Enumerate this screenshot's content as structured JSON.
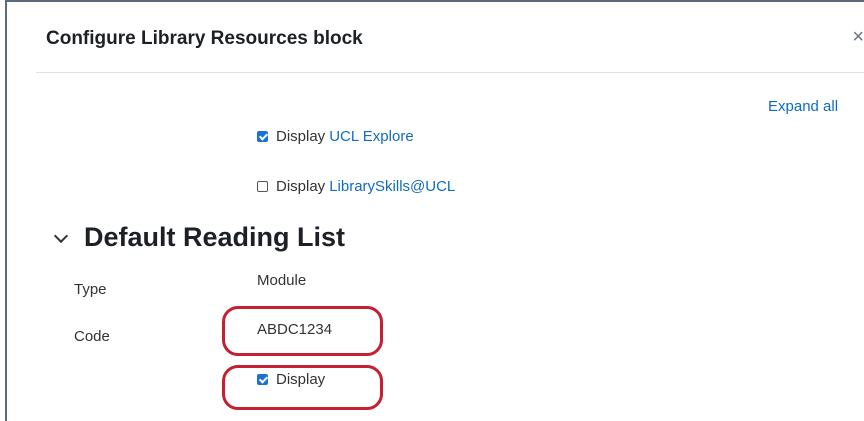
{
  "modal": {
    "title": "Configure Library Resources block",
    "close_glyph": "×"
  },
  "expand_all": "Expand all",
  "options": [
    {
      "prefix": "Display",
      "link": "UCL Explore",
      "checked": true
    },
    {
      "prefix": "Display",
      "link": "LibrarySkills@UCL",
      "checked": false
    }
  ],
  "section": {
    "title": "Default Reading List",
    "type_label": "Type",
    "type_value": "Module",
    "code_label": "Code",
    "code_value": "ABDC1234",
    "display_label": "Display",
    "display_checked": true
  },
  "highlight_color": "#c42031",
  "accent_color": "#0f6cbf"
}
